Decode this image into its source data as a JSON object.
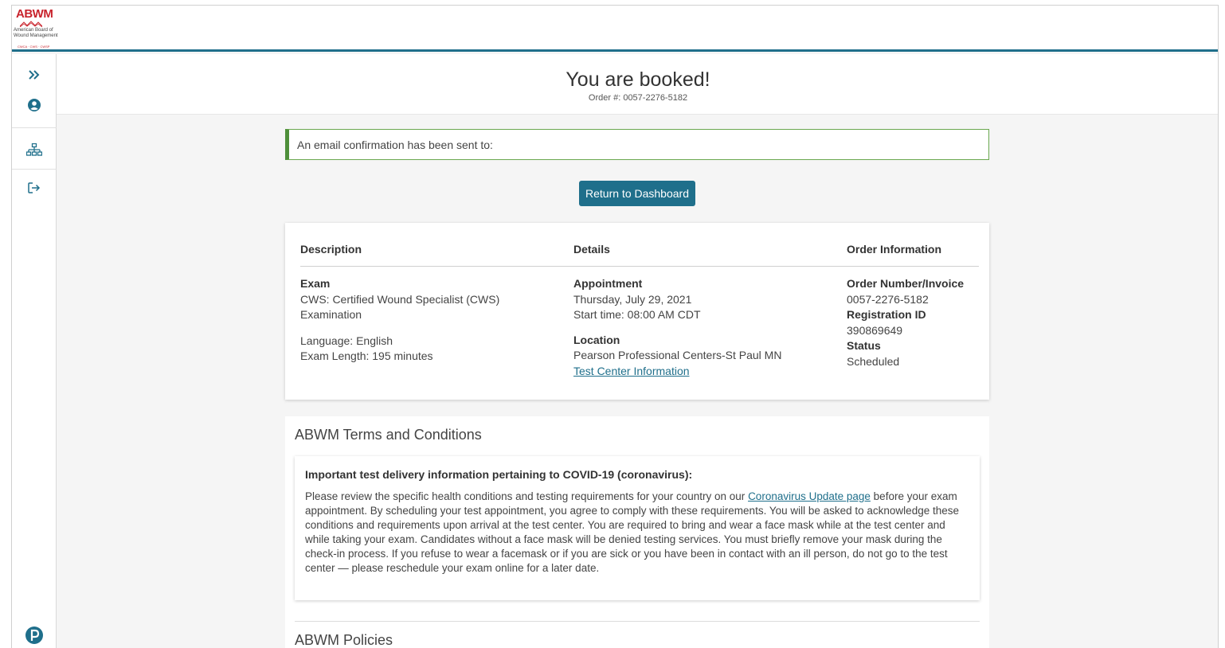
{
  "logo": {
    "acronym": "ABWM",
    "org_name": "American Board of Wound Management",
    "certs": "CWCA · CWS · CWSP"
  },
  "sidebar": {
    "items": [
      {
        "name": "expand",
        "icon": "chevrons-right-icon"
      },
      {
        "name": "account",
        "icon": "user-circle-icon"
      },
      {
        "name": "sitemap",
        "icon": "sitemap-icon"
      },
      {
        "name": "logout",
        "icon": "sign-out-icon"
      }
    ],
    "footer_icon": "pearson-logo-icon"
  },
  "header": {
    "title": "You are booked!",
    "order_line": "Order #: 0057-2276-5182"
  },
  "alert": {
    "text": "An email confirmation has been sent to:"
  },
  "return_button": "Return to Dashboard",
  "summary": {
    "columns": [
      "Description",
      "Details",
      "Order Information"
    ],
    "description": {
      "heading": "Exam",
      "exam_name": "CWS: Certified Wound Specialist (CWS) Examination",
      "language": "Language: English",
      "length": "Exam Length: 195 minutes"
    },
    "details": {
      "appointment_heading": "Appointment",
      "date": "Thursday, July 29, 2021",
      "start_time": "Start time: 08:00 AM CDT",
      "location_heading": "Location",
      "location": "Pearson Professional Centers-St Paul MN",
      "test_center_link": "Test Center Information"
    },
    "order_info": {
      "order_heading": "Order Number/Invoice",
      "order_number": "0057-2276-5182",
      "registration_heading": "Registration ID",
      "registration_id": "390869649",
      "status_heading": "Status",
      "status": "Scheduled"
    }
  },
  "terms": {
    "title": "ABWM Terms and Conditions",
    "covid_title": "Important test delivery information pertaining to COVID-19 (coronavirus):",
    "covid_pre_link": "Please review the specific health conditions and testing requirements for your country on our ",
    "covid_link": "Coronavirus Update page",
    "covid_post_link": " before your exam appointment. By scheduling your test appointment, you agree to comply with these requirements. You will be asked to acknowledge these conditions and requirements upon arrival at the test center. You are required to bring and wear a face mask while at the test center and while taking your exam. Candidates without a face mask will be denied testing services. You must briefly remove your mask during the check-in process. If you refuse to wear a facemask or if you are sick or you have been in contact with an ill person, do not go to the test center — please reschedule your exam online for a later date.",
    "policies_title": "ABWM Policies"
  },
  "colors": {
    "brand_teal": "#1f6f8b",
    "alert_green": "#4e8f3a",
    "logo_red": "#c8232c"
  }
}
